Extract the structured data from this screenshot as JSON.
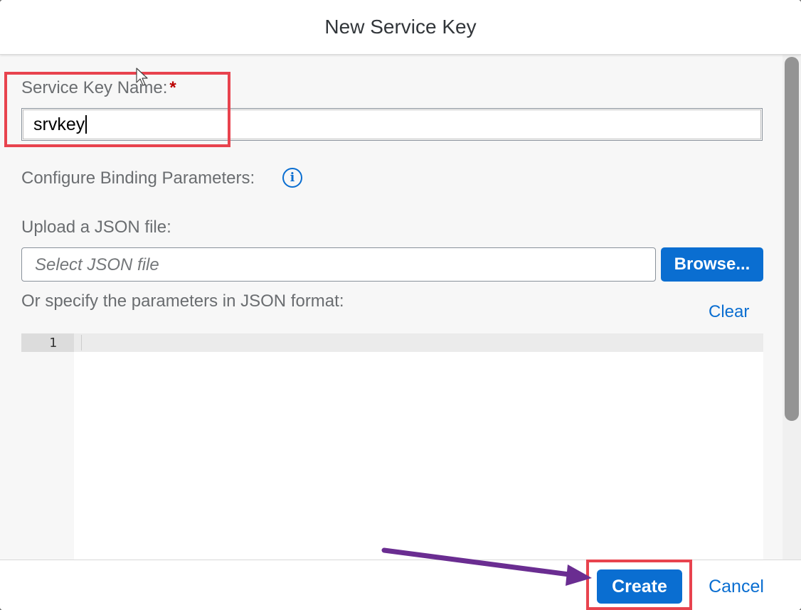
{
  "dialog": {
    "title": "New Service Key"
  },
  "form": {
    "service_key_name_label": "Service Key Name:",
    "required_marker": "*",
    "service_key_name_value": "srvkey",
    "binding_params_label": "Configure Binding Parameters:",
    "info_icon_glyph": "i",
    "upload_label": "Upload a JSON file:",
    "file_placeholder": "Select JSON file",
    "browse_label": "Browse...",
    "json_format_label": "Or specify the parameters in JSON format:",
    "clear_label": "Clear",
    "editor_line_number": "1"
  },
  "footer": {
    "create_label": "Create",
    "cancel_label": "Cancel"
  },
  "colors": {
    "accent": "#0a6ed1",
    "highlight": "#e8434e",
    "arrow": "#6a2d91",
    "required": "#bb0000"
  },
  "icons": {
    "info": "info-icon",
    "pointer": "mouse-pointer-icon",
    "annotation_arrow": "arrow-icon"
  }
}
